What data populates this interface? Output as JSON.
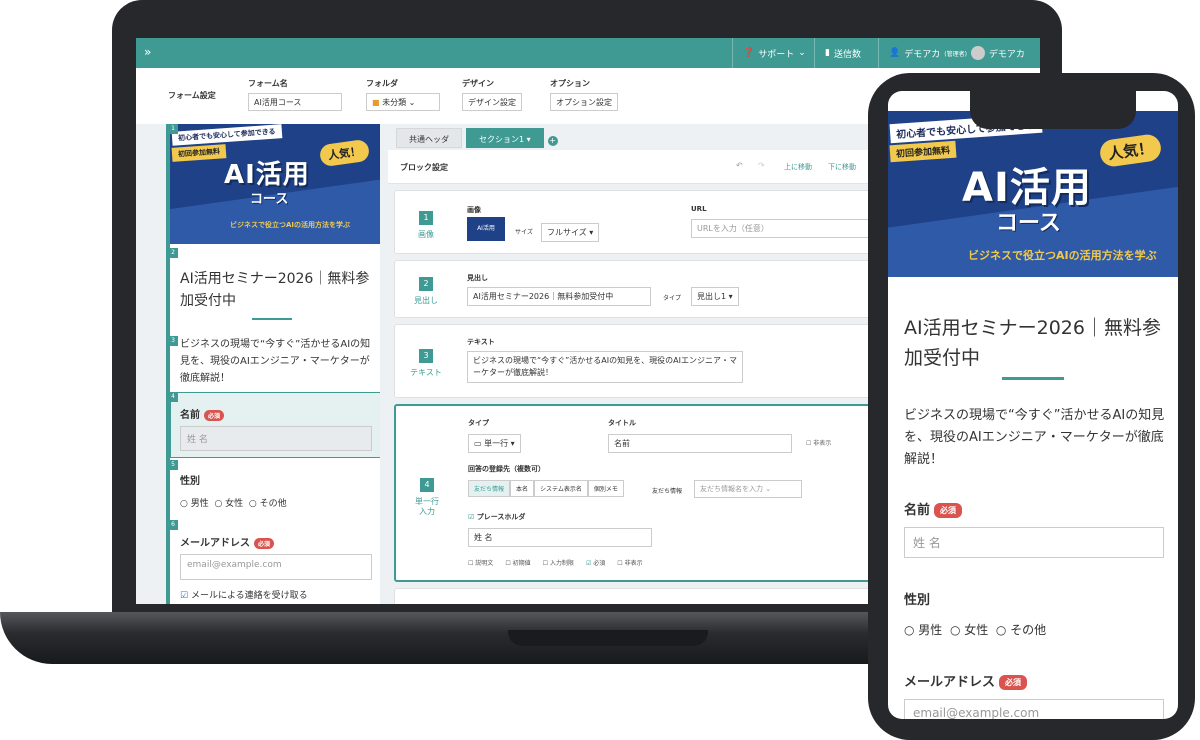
{
  "topbar": {
    "collapse_icon": "»",
    "support": "サポート",
    "sent": "送信数",
    "user_account": "デモアカ",
    "user_role": "(管理者)",
    "user_name": "デモアカ"
  },
  "settings": {
    "form_settings": "フォーム設定",
    "form_name_label": "フォーム名",
    "form_name_value": "AI活用コース",
    "folder_label": "フォルダ",
    "folder_value": "未分類",
    "design_label": "デザイン",
    "design_button": "デザイン設定",
    "option_label": "オプション",
    "option_button": "オプション設定"
  },
  "banner": {
    "tag1": "初心者でも安心して参加できる",
    "tag2": "初回参加無料",
    "popular": "人気！",
    "title": "AI活用",
    "subtitle": "コース",
    "desc": "ビジネスで役立つAIの活用方法を学ぶ"
  },
  "form": {
    "heading": "AI活用セミナー2026｜無料参加受付中",
    "text": "ビジネスの現場で“今すぐ”活かせるAIの知見を、現役のAIエンジニア・マーケターが徹底解説！",
    "name_label": "名前",
    "required": "必須",
    "name_placeholder": "姓 名",
    "gender_label": "性別",
    "gender_options": [
      "男性",
      "女性",
      "その他"
    ],
    "email_label": "メールアドレス",
    "email_placeholder": "email@example.com",
    "email_opt": "メールによる連絡を受け取る",
    "nums": [
      "1",
      "2",
      "3",
      "4",
      "5",
      "6"
    ]
  },
  "editor": {
    "tab_common": "共通ヘッダ",
    "tab_section": "セクション1",
    "block_settings": "ブロック設定",
    "move_up": "上に移動",
    "move_down": "下に移動",
    "b1": {
      "num": "1",
      "type": "画像",
      "image_label": "画像",
      "size_label": "サイズ",
      "size_value": "フルサイズ",
      "url_label": "URL",
      "url_placeholder": "URLを入力（任意）",
      "thumb": "AI活用"
    },
    "b2": {
      "num": "2",
      "type": "見出し",
      "label": "見出し",
      "value": "AI活用セミナー2026｜無料参加受付中",
      "type_label": "タイプ",
      "type_value": "見出し1"
    },
    "b3": {
      "num": "3",
      "type": "テキスト",
      "label": "テキスト",
      "value": "ビジネスの現場で“今すぐ”活かせるAIの知見を、現役のAIエンジニア・マーケターが徹底解説！"
    },
    "b4": {
      "num": "4",
      "type1": "単一行",
      "type2": "入力",
      "type_label": "タイプ",
      "type_value": "単一行",
      "title_label": "タイトル",
      "title_value": "名前",
      "hide": "非表示",
      "dest_label": "回答の登録先（複数可）",
      "dest_tabs": [
        "友だち情報",
        "本名",
        "システム表示名",
        "個別メモ"
      ],
      "friend_label": "友だち情報",
      "friend_placeholder": "友だち情報名を入力",
      "placeholder_label": "プレースホルダ",
      "placeholder_value": "姓 名",
      "opts": [
        "説明文",
        "初期値",
        "入力制限",
        "必須",
        "非表示"
      ]
    }
  }
}
